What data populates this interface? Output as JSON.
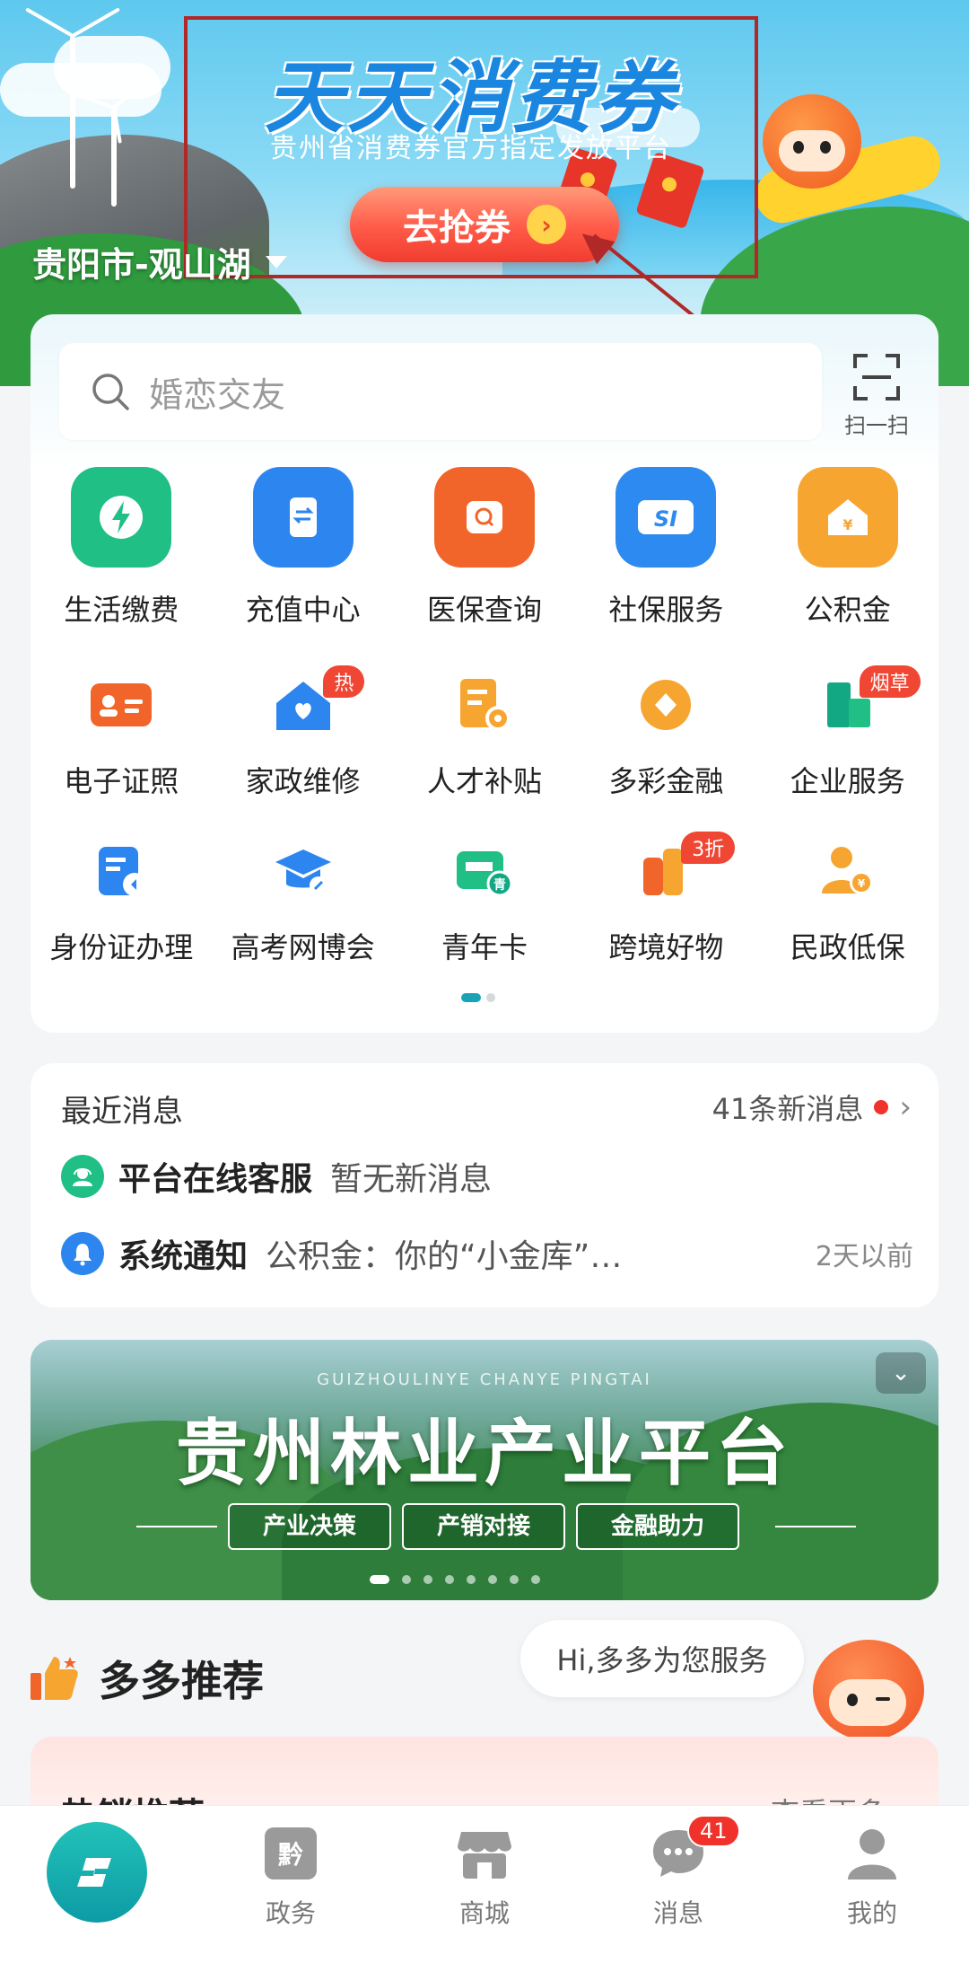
{
  "hero": {
    "title": "天天消费券",
    "subtitle": "贵州省消费券官方指定发放平台",
    "cta": "去抢券",
    "location": "贵阳市-观山湖"
  },
  "search": {
    "placeholder": "婚恋交友",
    "scan_label": "扫一扫"
  },
  "services": {
    "row1": [
      {
        "label": "生活缴费",
        "icon": "bolt-icon",
        "color": "#1fbf86"
      },
      {
        "label": "充值中心",
        "icon": "phone-recharge-icon",
        "color": "#2d86f0"
      },
      {
        "label": "医保查询",
        "icon": "medical-search-icon",
        "color": "#f2652a"
      },
      {
        "label": "社保服务",
        "icon": "si-icon",
        "color": "#2d8af0"
      },
      {
        "label": "公积金",
        "icon": "house-fund-icon",
        "color": "#f7a531"
      }
    ],
    "row2": [
      {
        "label": "电子证照",
        "icon": "id-card-icon",
        "badge": ""
      },
      {
        "label": "家政维修",
        "icon": "home-repair-icon",
        "badge": "热"
      },
      {
        "label": "人才补贴",
        "icon": "talent-subsidy-icon",
        "badge": ""
      },
      {
        "label": "多彩金融",
        "icon": "coin-icon",
        "badge": ""
      },
      {
        "label": "企业服务",
        "icon": "enterprise-icon",
        "badge": "烟草"
      }
    ],
    "row3": [
      {
        "label": "身份证办理",
        "icon": "id-process-icon",
        "badge": ""
      },
      {
        "label": "高考网博会",
        "icon": "graduation-cap-icon",
        "badge": ""
      },
      {
        "label": "青年卡",
        "icon": "youth-card-icon",
        "badge": ""
      },
      {
        "label": "跨境好物",
        "icon": "cross-border-goods-icon",
        "badge": "3折"
      },
      {
        "label": "民政低保",
        "icon": "civil-welfare-icon",
        "badge": ""
      }
    ]
  },
  "messages": {
    "title": "最近消息",
    "new_count": "41条新消息",
    "items": [
      {
        "name": "平台在线客服",
        "desc": "暂无新消息",
        "time": "",
        "icon": "customer-service-icon"
      },
      {
        "name": "系统通知",
        "desc": "公积金：你的“小金库”…",
        "time": "2天以前",
        "icon": "bell-icon"
      }
    ]
  },
  "forest_banner": {
    "pinyin": "GUIZHOULINYE CHANYE PINGTAI",
    "title": "贵州林业产业平台",
    "tags": [
      "产业决策",
      "产销对接",
      "金融助力"
    ]
  },
  "recommend": {
    "title": "多多推荐",
    "bubble": "Hi,多多为您服务",
    "hot_title": "热销推荐",
    "more": "查看更多 ›"
  },
  "tabbar": {
    "items": [
      {
        "label": "",
        "icon": "home-logo-icon"
      },
      {
        "label": "政务",
        "icon": "government-icon"
      },
      {
        "label": "商城",
        "icon": "mall-icon"
      },
      {
        "label": "消息",
        "icon": "message-icon",
        "count": "41"
      },
      {
        "label": "我的",
        "icon": "profile-icon"
      }
    ]
  }
}
